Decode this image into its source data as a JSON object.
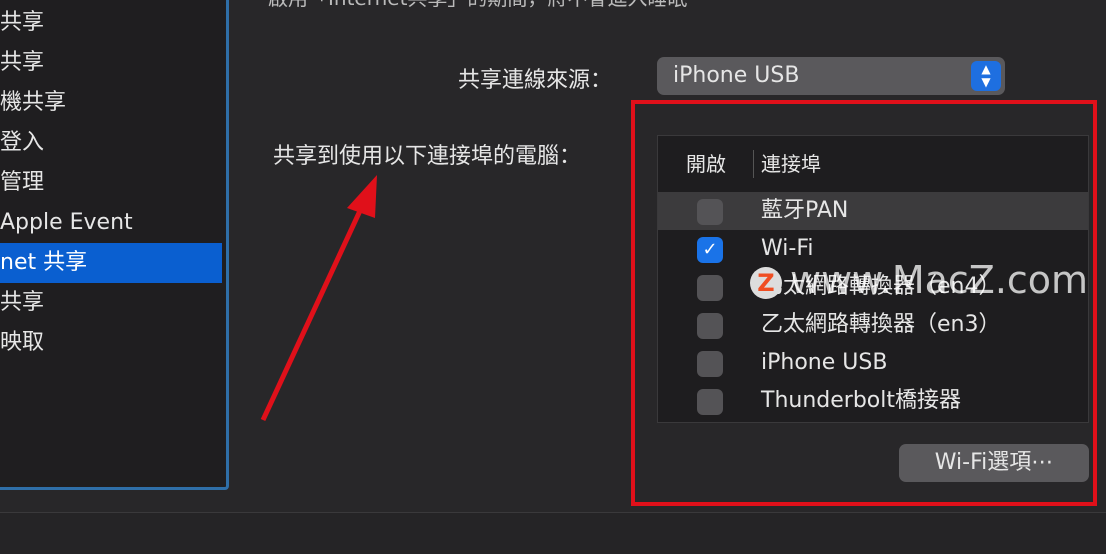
{
  "sidebar": {
    "items": [
      {
        "label": "共享"
      },
      {
        "label": "共享"
      },
      {
        "label": "機共享"
      },
      {
        "label": "登入"
      },
      {
        "label": "管理"
      },
      {
        "label": "Apple Event"
      },
      {
        "label": "net 共享",
        "selected": true
      },
      {
        "label": "共享"
      },
      {
        "label": "映取"
      }
    ]
  },
  "main": {
    "top_note": "啟用「Internet共享」的期間，將不會進入睡眠",
    "source_label": "共享連線來源：",
    "source_value": "iPhone USB",
    "share_label": "共享到使用以下連接埠的電腦：",
    "table": {
      "headers": [
        "開啟",
        "連接埠"
      ],
      "rows": [
        {
          "label": "藍牙PAN",
          "checked": false
        },
        {
          "label": "Wi-Fi",
          "checked": true
        },
        {
          "label": "乙太網路轉換器（en4）",
          "checked": false
        },
        {
          "label": "乙太網路轉換器（en3）",
          "checked": false
        },
        {
          "label": "iPhone USB",
          "checked": false
        },
        {
          "label": "Thunderbolt橋接器",
          "checked": false
        }
      ]
    },
    "wifi_options": "Wi-Fi選項⋯"
  },
  "watermark": "www.MacZ.com",
  "colors": {
    "accent": "#0a5fd0",
    "highlight_box": "#e0101a",
    "arrow": "#e0101a"
  }
}
